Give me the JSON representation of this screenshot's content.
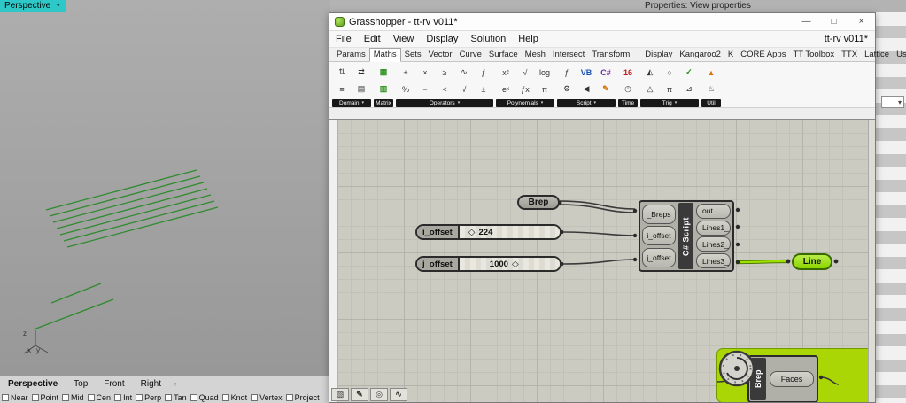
{
  "behind": {
    "properties_title": "Properties: View properties",
    "dropdown_icon": "▾"
  },
  "colors": {
    "viewport_teal": "#2ec8c8",
    "curve_green": "#2e8b2e",
    "selected_green": "#8bd500",
    "wire_green": "#a0e000",
    "group_green": "#aad606",
    "canvas_bg": "#cbcbc2"
  },
  "rhino": {
    "viewport_label": "Perspective",
    "viewport_menu_icon": "▼",
    "axis_z": "z",
    "axis_x": "x",
    "axis_y": "y",
    "viewport_tabs": [
      "Perspective",
      "Top",
      "Front",
      "Right"
    ],
    "viewport_link_icon": "○",
    "osnap_items": [
      "Near",
      "Point",
      "Mid",
      "Cen",
      "Int",
      "Perp",
      "Tan",
      "Quad",
      "Knot",
      "Vertex",
      "Project"
    ]
  },
  "gh": {
    "title": "Grasshopper - tt-rv v011*",
    "doc_name": "tt-rv v011*",
    "window_buttons": {
      "minimize": "—",
      "maximize": "□",
      "close": "×"
    },
    "menus": [
      "File",
      "Edit",
      "View",
      "Display",
      "Solution",
      "Help"
    ],
    "tabs": [
      "Params",
      "Maths",
      "Sets",
      "Vector",
      "Curve",
      "Surface",
      "Mesh",
      "Intersect",
      "Transform",
      "Display",
      "Kangaroo2",
      "K",
      "CORE Apps",
      "TT Toolbox",
      "TTX",
      "Lattice",
      "User"
    ],
    "group_dropdown_icon": "▾",
    "groups": [
      {
        "label": "Domain",
        "icons": [
          "⇅",
          "⇄",
          "≡",
          "▤"
        ]
      },
      {
        "label": "Matrix",
        "icons": [
          "▦",
          "▥"
        ]
      },
      {
        "label": "Operators",
        "icons": [
          "+",
          "×",
          "≥",
          "∿",
          "ƒ",
          "%",
          "−",
          "<",
          "√",
          "±"
        ]
      },
      {
        "label": "Polynomials",
        "icons": [
          "x²",
          "√",
          "log",
          "eˣ",
          "ƒx",
          "π"
        ]
      },
      {
        "label": "Script",
        "icons": [
          "ƒ",
          "VB",
          "C#",
          "⚙",
          "◀",
          "✎"
        ]
      },
      {
        "label": "Time",
        "icons": [
          "16",
          "◷"
        ]
      },
      {
        "label": "Trig",
        "icons": [
          "◭",
          "○",
          "✓",
          "△",
          "π",
          "⊿"
        ]
      },
      {
        "label": "Util",
        "icons": [
          "▲",
          "♨"
        ]
      }
    ]
  },
  "canvas": {
    "brep": {
      "label": "Brep"
    },
    "slider_i": {
      "label": "i_offset",
      "value": "224",
      "grip": "◇"
    },
    "slider_j": {
      "label": "j_offset",
      "value": "1000",
      "grip": "◇"
    },
    "script": {
      "label": "C# Script",
      "inputs": [
        "_Breps",
        "i_offset",
        "j_offset"
      ],
      "outputs": [
        "out",
        "Lines1_",
        "Lines2_",
        "Lines3_"
      ]
    },
    "line": {
      "label": "Line"
    },
    "group": {
      "component_label": "Brep",
      "output_label": "Faces"
    }
  },
  "widgets": {
    "icons": [
      "▧",
      "✎",
      "◎",
      "∿"
    ]
  }
}
